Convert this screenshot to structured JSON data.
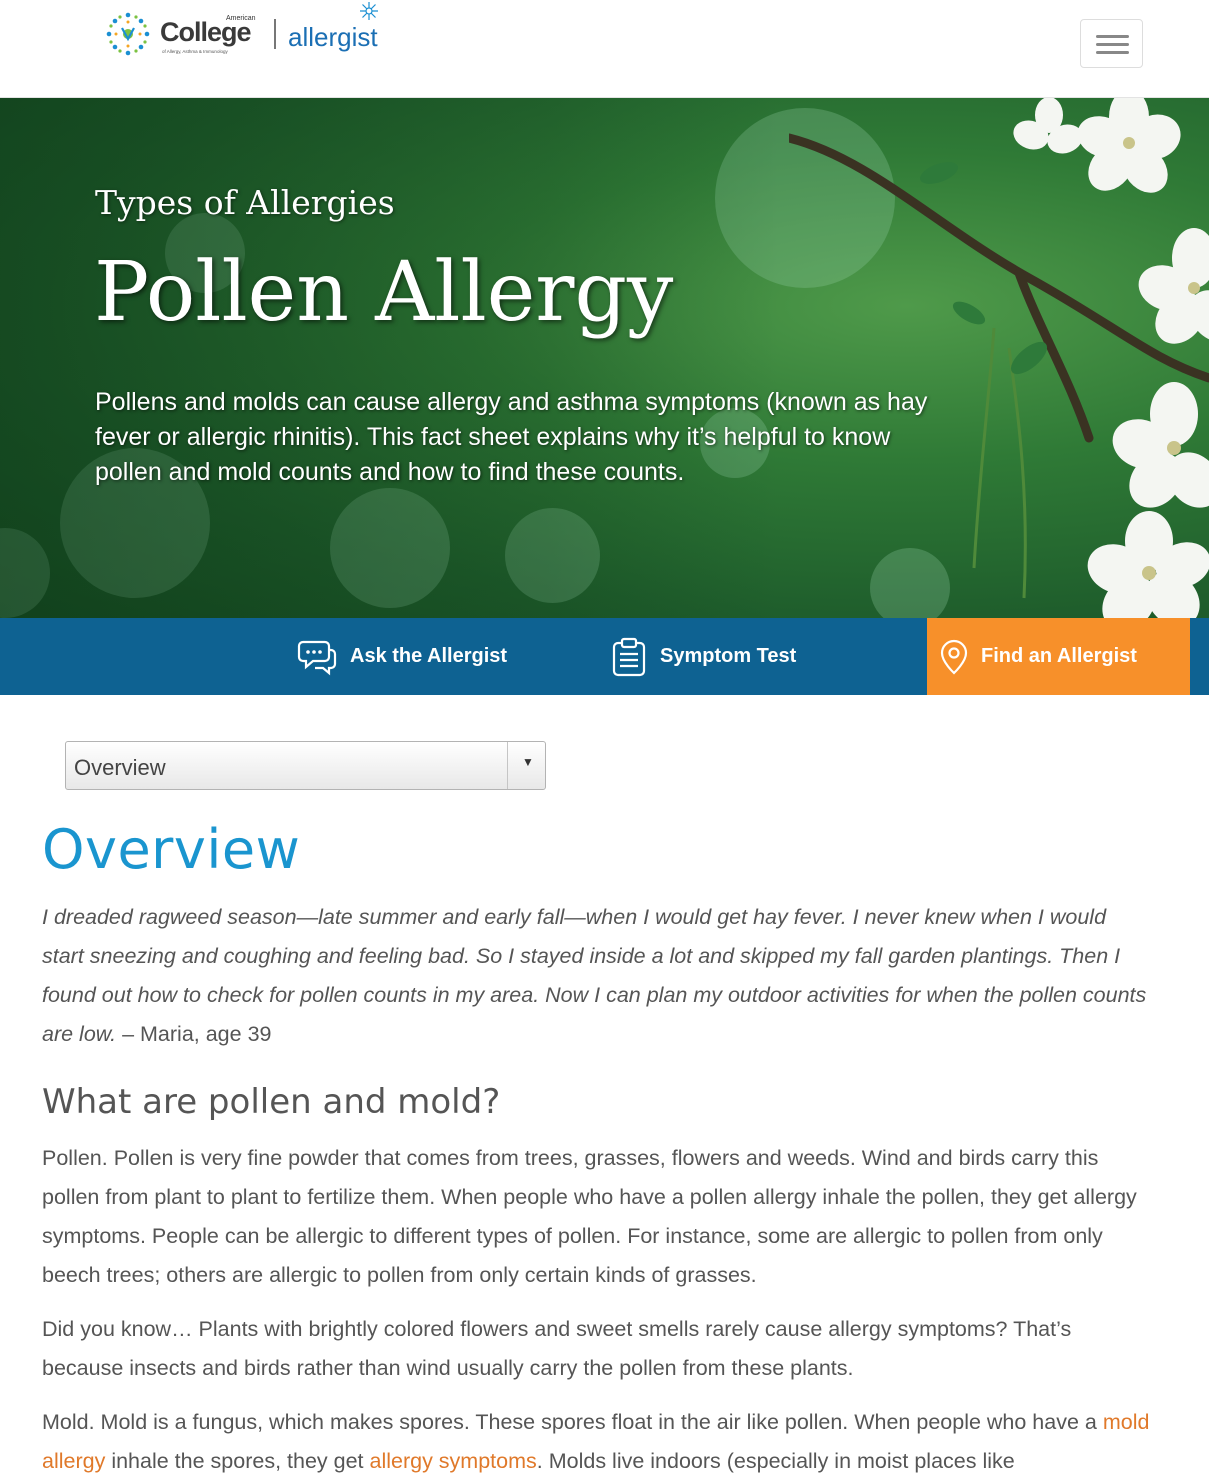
{
  "header": {
    "logo": {
      "american": "American",
      "college": "College",
      "college_sub": "of Allergy, Asthma & Immunology",
      "allergist": "allergist"
    },
    "menu_icon": "hamburger-icon"
  },
  "hero": {
    "pretitle": "Types of Allergies",
    "title": "Pollen Allergy",
    "description": "Pollens and molds can cause allergy and asthma symptoms (known as hay fever or allergic rhinitis). This fact sheet explains why it’s helpful to know pollen and mold counts and how to find these counts."
  },
  "actions": {
    "ask": {
      "label": "Ask the Allergist",
      "icon": "chat-bubbles-icon"
    },
    "symptom": {
      "label": "Symptom Test",
      "icon": "clipboard-icon"
    },
    "find": {
      "label": "Find an Allergist",
      "icon": "map-pin-icon"
    }
  },
  "section_select": {
    "value": "Overview"
  },
  "content": {
    "heading": "Overview",
    "quote": "I dreaded ragweed season—late summer and early fall—when I would get hay fever. I never knew when I would start sneezing and coughing and feeling bad. So I stayed inside a lot and skipped my fall garden plantings. Then I found out how to check for pollen counts in my area. Now I can plan my outdoor activities for when the pollen counts are low.",
    "quote_author": " – Maria, age 39",
    "subheading": "What are pollen and mold?",
    "pollen_paragraph": "Pollen. Pollen is very fine powder that comes from trees, grasses, flowers and weeds. Wind and birds carry this pollen from plant to plant to fertilize them. When people who have a pollen allergy inhale the pollen, they get allergy symptoms. People can be allergic to different types of pollen. For instance, some are allergic to pollen from only beech trees; others are allergic to pollen from only certain kinds of grasses.",
    "didyouknow_paragraph": "Did you know… Plants with brightly colored flowers and sweet smells rarely cause allergy symptoms? That’s because insects and birds rather than wind usually carry the pollen from these plants.",
    "mold_intro": "Mold. Mold is a fungus, which makes spores. These spores float in the air like pollen. When people who have a ",
    "mold_link": "mold allergy",
    "mold_mid": " inhale the spores, they get ",
    "symptoms_link": "allergy symptoms",
    "mold_end": ". Molds live indoors (especially in moist places like"
  },
  "colors": {
    "heading_blue": "#1a95cf",
    "action_bar_blue": "#0e6292",
    "find_orange": "#f7902a",
    "link_orange": "#e0792a",
    "hero_green": "#2f7a36",
    "body_text": "#555555"
  }
}
